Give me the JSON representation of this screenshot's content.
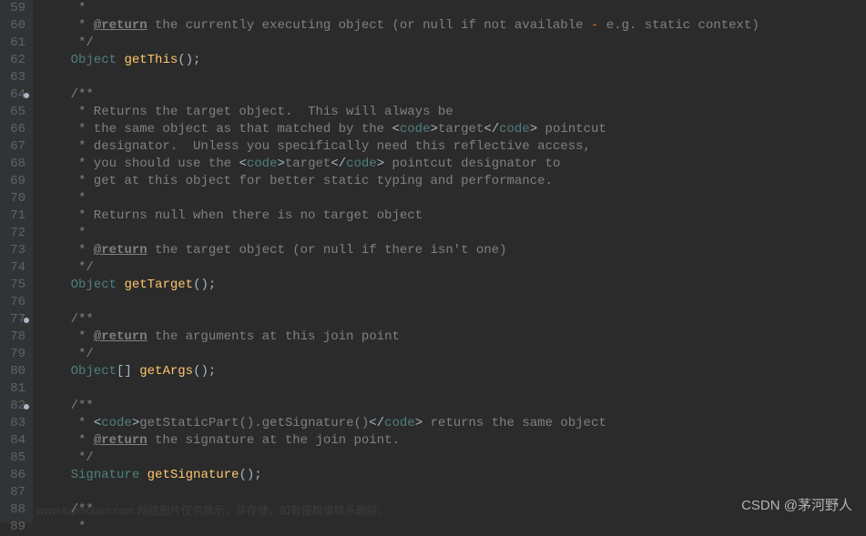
{
  "startLine": 59,
  "markers": [
    64,
    77,
    82
  ],
  "watermark": "CSDN @茅河野人",
  "faintText": "www.toymoban.com 网络图片仅供展示，非存储，如有侵权请联系删除。",
  "lines": [
    {
      "n": 59,
      "seg": [
        {
          "c": "comment",
          "t": "     *"
        }
      ]
    },
    {
      "n": 60,
      "seg": [
        {
          "c": "comment",
          "t": "     * "
        },
        {
          "c": "doc-tag",
          "t": "@return"
        },
        {
          "c": "comment",
          "t": " the currently executing object (or null if not available "
        },
        {
          "c": "dash-op",
          "t": "-"
        },
        {
          "c": "comment",
          "t": " e.g. static context)"
        }
      ]
    },
    {
      "n": 61,
      "seg": [
        {
          "c": "comment",
          "t": "     */"
        }
      ]
    },
    {
      "n": 62,
      "seg": [
        {
          "c": "punct",
          "t": "    "
        },
        {
          "c": "type",
          "t": "Object"
        },
        {
          "c": "punct",
          "t": " "
        },
        {
          "c": "method",
          "t": "getThis"
        },
        {
          "c": "punct",
          "t": "();"
        }
      ]
    },
    {
      "n": 63,
      "seg": [
        {
          "c": "punct",
          "t": ""
        }
      ]
    },
    {
      "n": 64,
      "seg": [
        {
          "c": "comment",
          "t": "    /**"
        }
      ]
    },
    {
      "n": 65,
      "seg": [
        {
          "c": "comment",
          "t": "     * Returns the target object.  This will always be"
        }
      ]
    },
    {
      "n": 66,
      "seg": [
        {
          "c": "comment",
          "t": "     * the same object as that matched by the "
        },
        {
          "c": "html-lt",
          "t": "<"
        },
        {
          "c": "type",
          "t": "code"
        },
        {
          "c": "html-lt",
          "t": ">"
        },
        {
          "c": "comment",
          "t": "target"
        },
        {
          "c": "html-lt",
          "t": "</"
        },
        {
          "c": "type",
          "t": "code"
        },
        {
          "c": "html-lt",
          "t": ">"
        },
        {
          "c": "comment",
          "t": " pointcut"
        }
      ]
    },
    {
      "n": 67,
      "seg": [
        {
          "c": "comment",
          "t": "     * designator.  Unless you specifically need this reflective access,"
        }
      ]
    },
    {
      "n": 68,
      "seg": [
        {
          "c": "comment",
          "t": "     * you should use the "
        },
        {
          "c": "html-lt",
          "t": "<"
        },
        {
          "c": "type",
          "t": "code"
        },
        {
          "c": "html-lt",
          "t": ">"
        },
        {
          "c": "comment",
          "t": "target"
        },
        {
          "c": "html-lt",
          "t": "</"
        },
        {
          "c": "type",
          "t": "code"
        },
        {
          "c": "html-lt",
          "t": ">"
        },
        {
          "c": "comment",
          "t": " pointcut designator to"
        }
      ]
    },
    {
      "n": 69,
      "seg": [
        {
          "c": "comment",
          "t": "     * get at this object for better static typing and performance."
        }
      ]
    },
    {
      "n": 70,
      "seg": [
        {
          "c": "comment",
          "t": "     *"
        }
      ]
    },
    {
      "n": 71,
      "seg": [
        {
          "c": "comment",
          "t": "     * Returns null when there is no target object"
        }
      ]
    },
    {
      "n": 72,
      "seg": [
        {
          "c": "comment",
          "t": "     *"
        }
      ]
    },
    {
      "n": 73,
      "seg": [
        {
          "c": "comment",
          "t": "     * "
        },
        {
          "c": "doc-tag",
          "t": "@return"
        },
        {
          "c": "comment",
          "t": " the target object (or null if there isn't one)"
        }
      ]
    },
    {
      "n": 74,
      "seg": [
        {
          "c": "comment",
          "t": "     */"
        }
      ]
    },
    {
      "n": 75,
      "seg": [
        {
          "c": "punct",
          "t": "    "
        },
        {
          "c": "type",
          "t": "Object"
        },
        {
          "c": "punct",
          "t": " "
        },
        {
          "c": "method",
          "t": "getTarget"
        },
        {
          "c": "punct",
          "t": "();"
        }
      ]
    },
    {
      "n": 76,
      "seg": [
        {
          "c": "punct",
          "t": ""
        }
      ]
    },
    {
      "n": 77,
      "seg": [
        {
          "c": "comment",
          "t": "    /**"
        }
      ]
    },
    {
      "n": 78,
      "seg": [
        {
          "c": "comment",
          "t": "     * "
        },
        {
          "c": "doc-tag",
          "t": "@return"
        },
        {
          "c": "comment",
          "t": " the arguments at this join point"
        }
      ]
    },
    {
      "n": 79,
      "seg": [
        {
          "c": "comment",
          "t": "     */"
        }
      ]
    },
    {
      "n": 80,
      "seg": [
        {
          "c": "punct",
          "t": "    "
        },
        {
          "c": "type",
          "t": "Object"
        },
        {
          "c": "punct",
          "t": "[] "
        },
        {
          "c": "method",
          "t": "getArgs"
        },
        {
          "c": "punct",
          "t": "();"
        }
      ]
    },
    {
      "n": 81,
      "seg": [
        {
          "c": "punct",
          "t": ""
        }
      ]
    },
    {
      "n": 82,
      "seg": [
        {
          "c": "comment",
          "t": "    /**"
        }
      ]
    },
    {
      "n": 83,
      "seg": [
        {
          "c": "comment",
          "t": "     * "
        },
        {
          "c": "html-lt",
          "t": "<"
        },
        {
          "c": "type",
          "t": "code"
        },
        {
          "c": "html-lt",
          "t": ">"
        },
        {
          "c": "comment",
          "t": "getStaticPart().getSignature()"
        },
        {
          "c": "html-lt",
          "t": "</"
        },
        {
          "c": "type",
          "t": "code"
        },
        {
          "c": "html-lt",
          "t": ">"
        },
        {
          "c": "comment",
          "t": " returns the same object"
        }
      ]
    },
    {
      "n": 84,
      "seg": [
        {
          "c": "comment",
          "t": "     * "
        },
        {
          "c": "doc-tag",
          "t": "@return"
        },
        {
          "c": "comment",
          "t": " the signature at the join point."
        }
      ]
    },
    {
      "n": 85,
      "seg": [
        {
          "c": "comment",
          "t": "     */"
        }
      ]
    },
    {
      "n": 86,
      "seg": [
        {
          "c": "punct",
          "t": "    "
        },
        {
          "c": "type",
          "t": "Signature"
        },
        {
          "c": "punct",
          "t": " "
        },
        {
          "c": "method",
          "t": "getSignature"
        },
        {
          "c": "punct",
          "t": "();"
        }
      ]
    },
    {
      "n": 87,
      "seg": [
        {
          "c": "punct",
          "t": ""
        }
      ]
    },
    {
      "n": 88,
      "seg": [
        {
          "c": "comment",
          "t": "    /**"
        }
      ]
    },
    {
      "n": 89,
      "seg": [
        {
          "c": "comment",
          "t": "     *"
        }
      ]
    }
  ]
}
